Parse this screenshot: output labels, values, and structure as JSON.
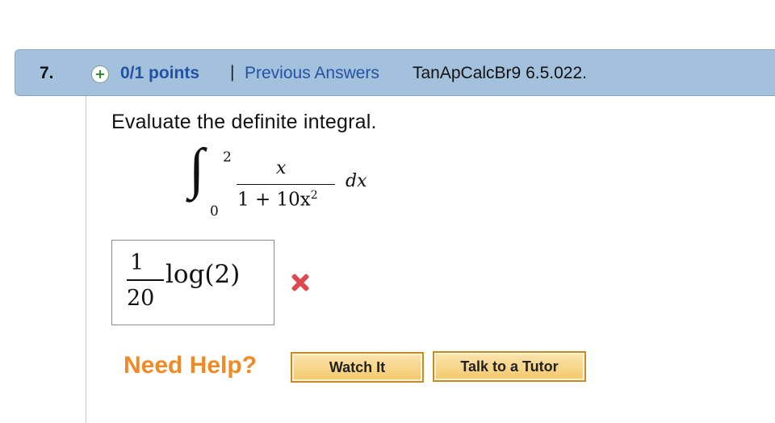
{
  "question": {
    "number": "7.",
    "points": "0/1 points",
    "separator": "|",
    "previous_answers": "Previous Answers",
    "code": "TanApCalcBr9 6.5.022."
  },
  "prompt": "Evaluate the definite integral.",
  "integral": {
    "upper": "2",
    "lower": "0",
    "numerator": "x",
    "denominator": "1 + 10x",
    "denominator_exponent": "2",
    "differential": "dx"
  },
  "answer": {
    "numerator": "1",
    "denominator": "20",
    "expression": "log(2)",
    "status": "incorrect"
  },
  "help": {
    "label": "Need Help?",
    "watch_it": "Watch It",
    "talk_to_tutor": "Talk to a Tutor"
  },
  "colors": {
    "header_bg": "#a3c1dc",
    "link_blue": "#2452a3",
    "help_orange": "#f08a24",
    "wrong_red": "#e0484f"
  }
}
